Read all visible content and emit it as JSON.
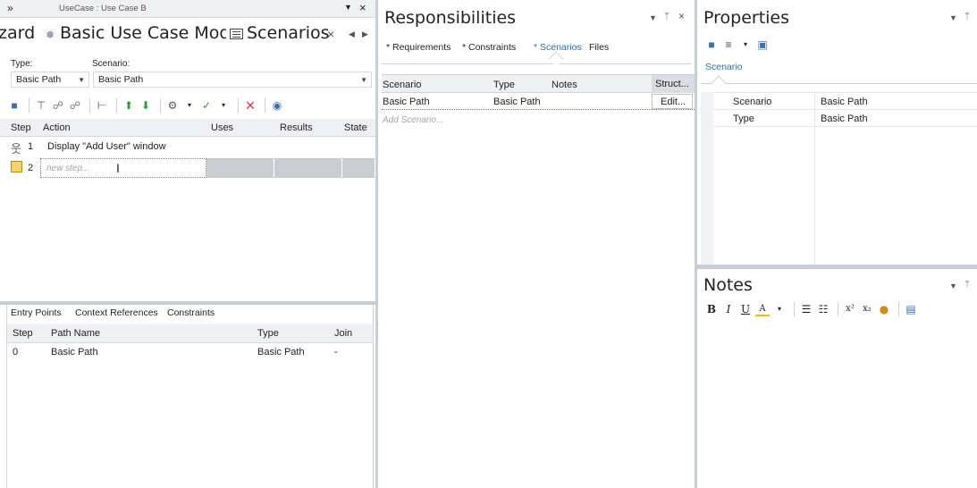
{
  "left_panel": {
    "breadcrumb": "UseCase : Use Case B",
    "tabs": {
      "wizard": "zard",
      "model": "Basic Use Case Model",
      "scenarios": "Scenarios"
    },
    "type_label": "Type:",
    "scenario_label": "Scenario:",
    "type_value": "Basic Path",
    "scenario_value": "Basic Path",
    "steps_headers": {
      "step": "Step",
      "action": "Action",
      "uses": "Uses",
      "results": "Results",
      "state": "State"
    },
    "steps": [
      {
        "num": "1",
        "action": "Display \"Add User\" window"
      },
      {
        "num": "2",
        "placeholder": "new step..."
      }
    ],
    "bottom_tabs": [
      "Entry Points",
      "Context References",
      "Constraints"
    ],
    "entry_headers": {
      "step": "Step",
      "path_name": "Path Name",
      "type": "Type",
      "join": "Join"
    },
    "entry_rows": [
      {
        "step": "0",
        "path_name": "Basic Path",
        "type": "Basic Path",
        "join": "-"
      }
    ]
  },
  "mid_panel": {
    "title": "Responsibilities",
    "tabs": [
      "* Requirements",
      "* Constraints",
      "* Scenarios",
      "Files"
    ],
    "headers": {
      "scenario": "Scenario",
      "type": "Type",
      "notes": "Notes",
      "struct": "Struct..."
    },
    "rows": [
      {
        "scenario": "Basic Path",
        "type": "Basic Path",
        "notes": "",
        "action": "Edit..."
      }
    ],
    "add_placeholder": "Add Scenario..."
  },
  "right_panel": {
    "title": "Properties",
    "tab": "Scenario",
    "props": [
      {
        "name": "Scenario",
        "value": "Basic Path"
      },
      {
        "name": "Type",
        "value": "Basic Path"
      }
    ],
    "notes_title": "Notes"
  },
  "colors": {
    "accent": "#2b6cb0",
    "selected_tab_bg": "#ffffff",
    "header_bg": "#eef0f3",
    "placeholder": "#a0a4a8"
  }
}
